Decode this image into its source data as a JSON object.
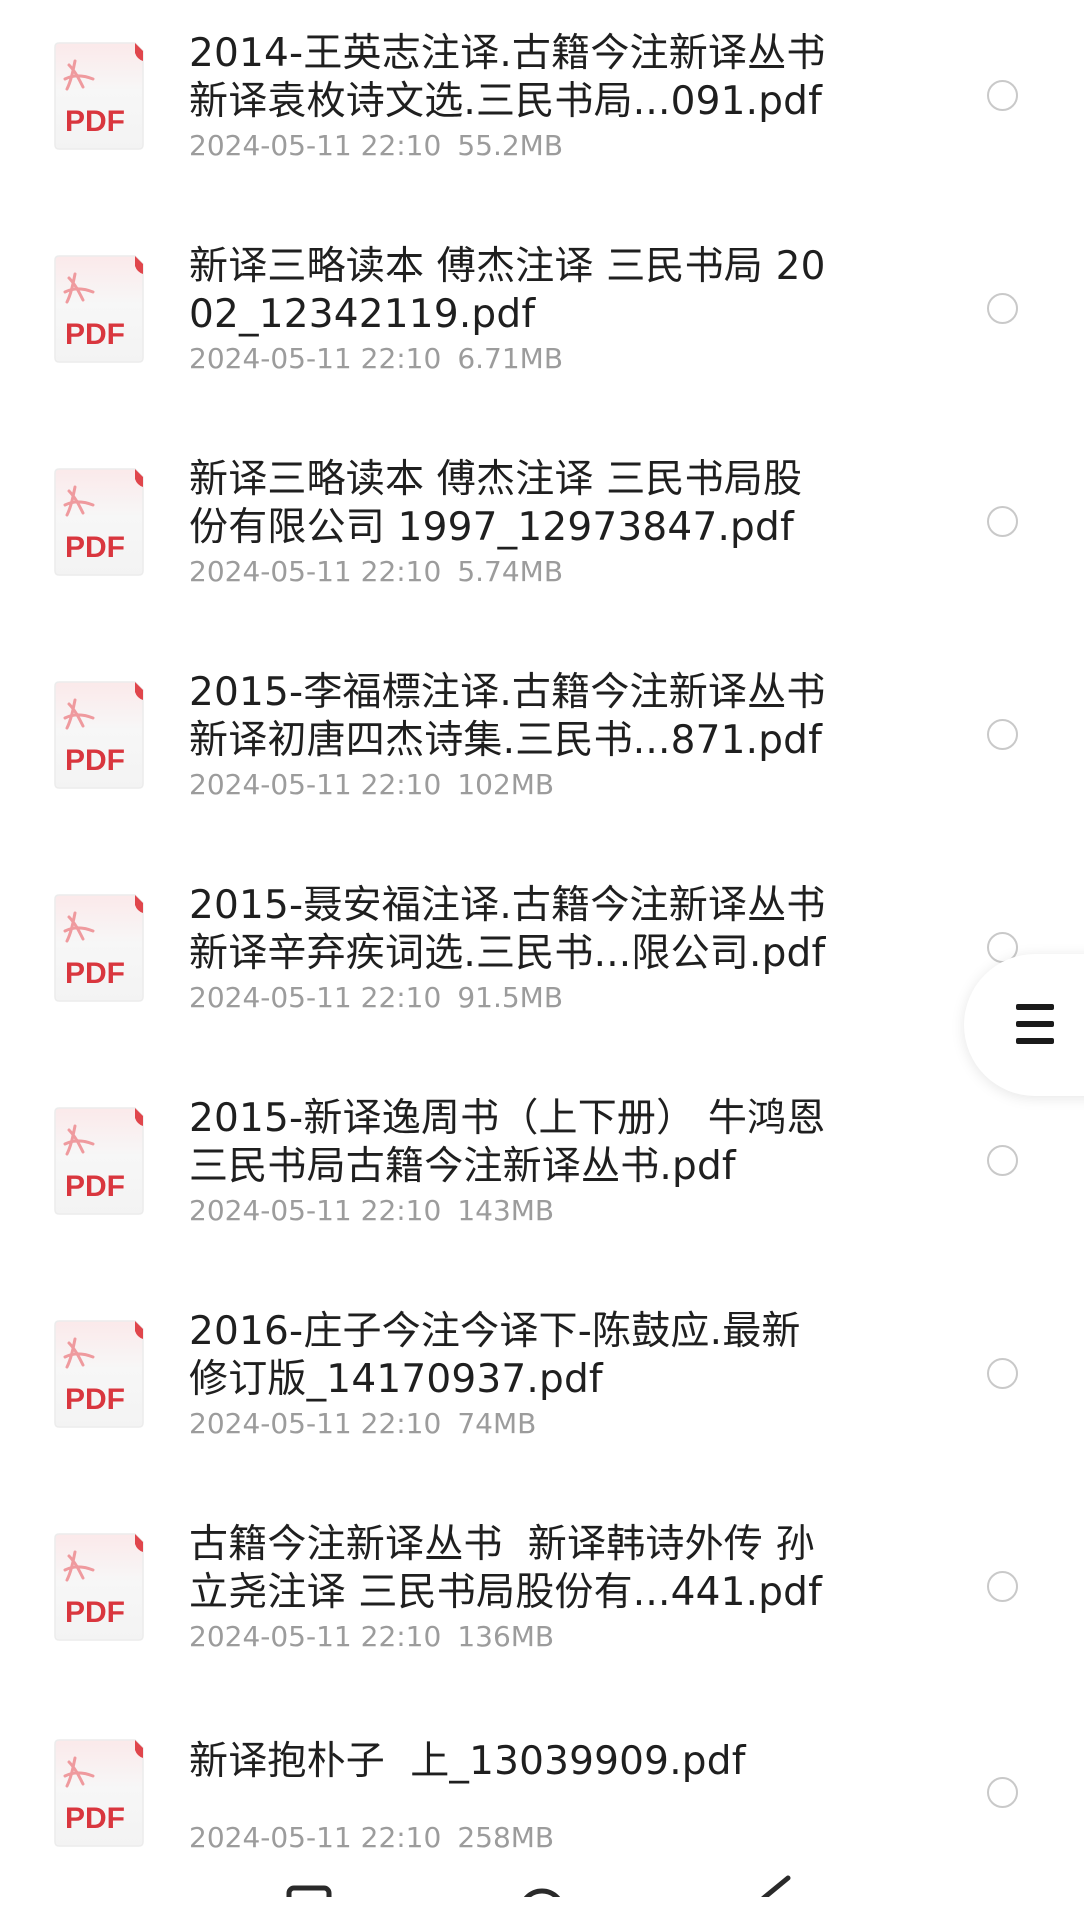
{
  "files": [
    {
      "name": "2014-王英志注译.古籍今注新译丛书\n新译袁枚诗文选.三民书局...091.pdf",
      "date": "2024-05-11 22:10",
      "size": "55.2MB",
      "icon": "PDF"
    },
    {
      "name": "新译三略读本 傅杰注译 三民书局 20\n02_12342119.pdf",
      "date": "2024-05-11 22:10",
      "size": "6.71MB",
      "icon": "PDF"
    },
    {
      "name": "新译三略读本 傅杰注译 三民书局股\n份有限公司 1997_12973847.pdf",
      "date": "2024-05-11 22:10",
      "size": "5.74MB",
      "icon": "PDF"
    },
    {
      "name": "2015-李福標注译.古籍今注新译丛书\n新译初唐四杰诗集.三民书...871.pdf",
      "date": "2024-05-11 22:10",
      "size": "102MB",
      "icon": "PDF"
    },
    {
      "name": "2015-聂安福注译.古籍今注新译丛书\n新译辛弃疾词选.三民书...限公司.pdf",
      "date": "2024-05-11 22:10",
      "size": "91.5MB",
      "icon": "PDF"
    },
    {
      "name": "2015-新译逸周书（上下册） 牛鸿恩\n三民书局古籍今注新译丛书.pdf",
      "date": "2024-05-11 22:10",
      "size": "143MB",
      "icon": "PDF"
    },
    {
      "name": "2016-庄子今注今译下-陈鼓应.最新\n修订版_14170937.pdf",
      "date": "2024-05-11 22:10",
      "size": "74MB",
      "icon": "PDF"
    },
    {
      "name": "古籍今注新译丛书  新译韩诗外传 孙\n立尧注译 三民书局股份有...441.pdf",
      "date": "2024-05-11 22:10",
      "size": "136MB",
      "icon": "PDF"
    },
    {
      "name": "新译抱朴子  上_13039909.pdf",
      "date": "2024-05-11 22:10",
      "size": "258MB",
      "icon": "PDF"
    }
  ],
  "colors": {
    "pdf_red": "#d9363e",
    "icon_bg": "#f7f7f7",
    "meta_gray": "#9c9c9c",
    "radio_border": "#c9c9c9"
  },
  "icons": {
    "file": "pdf-file-icon",
    "radio": "radio-unchecked-icon",
    "menu": "hamburger-menu-icon",
    "nav": [
      "square-nav-icon",
      "circle-home-icon",
      "triangle-back-icon"
    ]
  }
}
